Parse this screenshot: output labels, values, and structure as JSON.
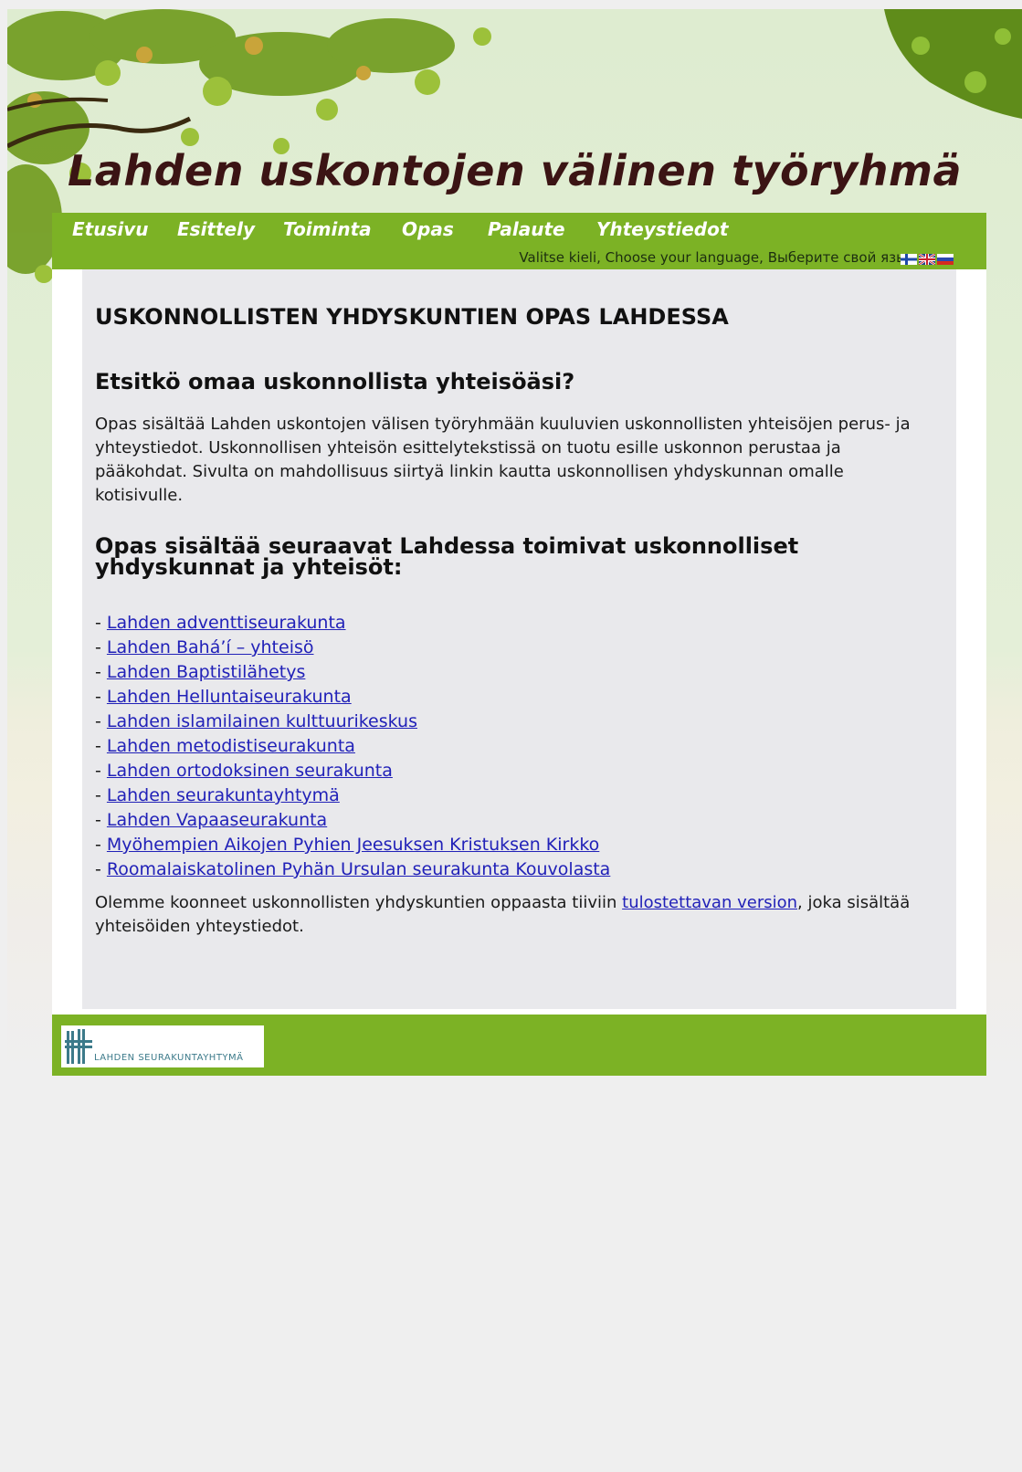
{
  "site": {
    "title": "Lahden uskontojen välinen työryhmä"
  },
  "nav": {
    "items": [
      {
        "label": "Etusivu"
      },
      {
        "label": "Esittely"
      },
      {
        "label": "Toiminta"
      },
      {
        "label": "Opas"
      },
      {
        "label": "Palaute"
      },
      {
        "label": "Yhteystiedot"
      }
    ],
    "language_prompt": "Valitse kieli, Choose your language, Выберите свой язык",
    "flags": [
      "finnish-flag-icon",
      "english-flag-icon",
      "russian-flag-icon"
    ]
  },
  "main": {
    "heading": "USKONNOLLISTEN YHDYSKUNTIEN OPAS LAHDESSA",
    "subheading": "Etsitkö omaa uskonnollista yhteisöäsi?",
    "intro": "Opas sisältää Lahden uskontojen välisen työryhmään kuuluvien uskonnollisten yhteisöjen perus- ja yhteystiedot. Uskonnollisen yhteisön esittelytekstissä on tuotu esille uskonnon perustaa ja pääkohdat. Sivulta on mahdollisuus siirtyä linkin kautta uskonnollisen yhdyskunnan omalle kotisivulle.",
    "list_heading": "Opas sisältää seuraavat Lahdessa toimivat uskonnolliset yhdyskunnat ja yhteisöt:",
    "list_prefix": "- ",
    "communities": [
      "Lahden adventtiseurakunta",
      "Lahden Bahá’í – yhteisö",
      "Lahden Baptistilähetys",
      "Lahden Helluntaiseurakunta",
      "Lahden islamilainen kulttuurikeskus",
      "Lahden metodistiseurakunta",
      "Lahden ortodoksinen seurakunta",
      "Lahden seurakuntayhtymä",
      "Lahden Vapaaseurakunta",
      "Myöhempien Aikojen Pyhien Jeesuksen Kristuksen Kirkko",
      "Roomalaiskatolinen Pyhän Ursulan seurakunta Kouvolasta"
    ],
    "print_text_before": "Olemme koonneet uskonnollisten yhdyskuntien oppaasta tiiviin ",
    "print_link": "tulostettavan version",
    "print_text_after": ", joka sisältää yhteisöiden yhteystiedot."
  },
  "footer": {
    "logo_text": "LAHDEN SEURAKUNTAYHTYMÄ"
  },
  "colors": {
    "nav_green": "#7cb225",
    "link_blue": "#2121b8",
    "title_brown": "#3b1414"
  }
}
